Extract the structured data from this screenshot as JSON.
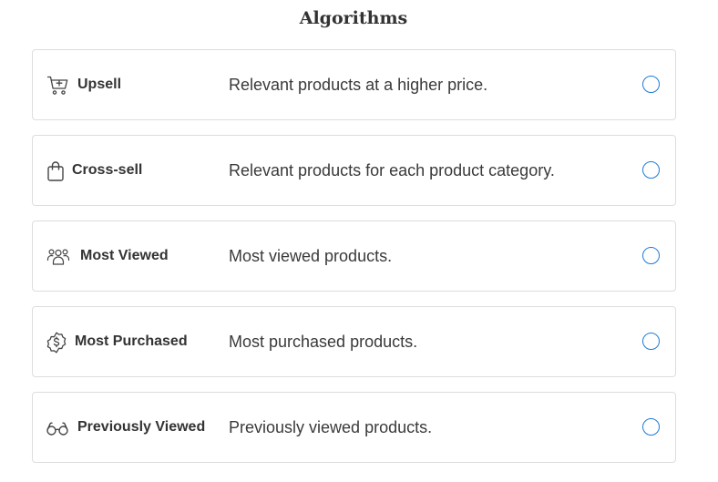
{
  "header": {
    "title": "Algorithms"
  },
  "accent_color": "#1f7ad6",
  "algorithms": [
    {
      "icon": "shopping-cart-add-icon",
      "name": "Upsell",
      "description": "Relevant products at a higher price.",
      "selected": false
    },
    {
      "icon": "shopping-bag-icon",
      "name": "Cross-sell",
      "description": "Relevant products for each product category.",
      "selected": false
    },
    {
      "icon": "users-group-icon",
      "name": "Most Viewed",
      "description": "Most viewed products.",
      "selected": false
    },
    {
      "icon": "dollar-badge-icon",
      "name": "Most Purchased",
      "description": "Most purchased products.",
      "selected": false
    },
    {
      "icon": "eyeglasses-icon",
      "name": "Previously Viewed",
      "description": "Previously viewed products.",
      "selected": false
    }
  ]
}
